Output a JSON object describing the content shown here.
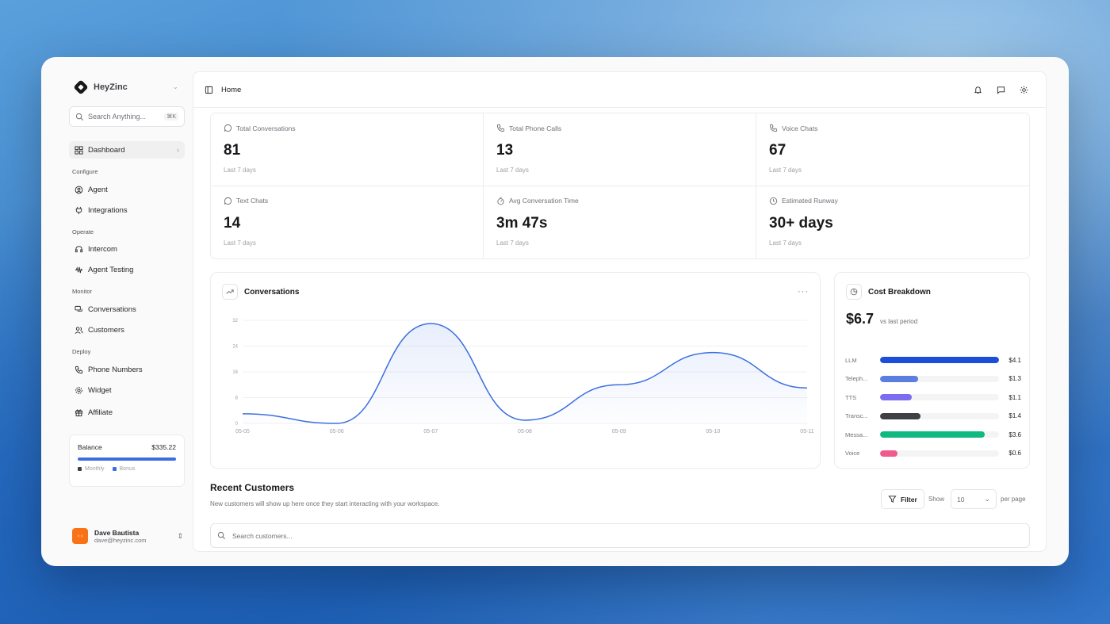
{
  "app": {
    "name": "HeyZinc"
  },
  "search": {
    "placeholder": "Search Anything...",
    "shortcut": "⌘K"
  },
  "sidebar": {
    "dashboard": "Dashboard",
    "sections": {
      "configure": "Configure",
      "operate": "Operate",
      "monitor": "Monitor",
      "deploy": "Deploy"
    },
    "items": {
      "agent": "Agent",
      "integrations": "Integrations",
      "intercom": "Intercom",
      "agent_testing": "Agent Testing",
      "conversations": "Conversations",
      "customers": "Customers",
      "phone_numbers": "Phone Numbers",
      "widget": "Widget",
      "affiliate": "Affiliate"
    }
  },
  "balance": {
    "label": "Balance",
    "amount": "$335.22",
    "legend_monthly": "Monthly",
    "legend_bonus": "Bonus",
    "colors": {
      "monthly": "#3f3f46",
      "bonus": "#3b6fe0"
    }
  },
  "user": {
    "name": "Dave Bautista",
    "email": "dave@heyzinc.com"
  },
  "header": {
    "breadcrumb": "Home"
  },
  "stats": [
    {
      "icon": "message-circle-icon",
      "label": "Total Conversations",
      "value": "81",
      "sub": "Last 7 days"
    },
    {
      "icon": "phone-icon",
      "label": "Total Phone Calls",
      "value": "13",
      "sub": "Last 7 days"
    },
    {
      "icon": "phone-icon",
      "label": "Voice Chats",
      "value": "67",
      "sub": "Last 7 days"
    },
    {
      "icon": "message-circle-icon",
      "label": "Text Chats",
      "value": "14",
      "sub": "Last 7 days"
    },
    {
      "icon": "timer-icon",
      "label": "Avg Conversation Time",
      "value": "3m 47s",
      "sub": "Last 7 days"
    },
    {
      "icon": "clock-icon",
      "label": "Estimated Runway",
      "value": "30+ days",
      "sub": "Last 7 days"
    }
  ],
  "conversations_chart": {
    "title": "Conversations",
    "more": "···"
  },
  "chart_data": {
    "type": "area",
    "title": "Conversations",
    "x": [
      "05-05",
      "05-06",
      "05-07",
      "05-08",
      "05-09",
      "05-10",
      "05-11"
    ],
    "series": [
      {
        "values": [
          3,
          0,
          31,
          1,
          12,
          22,
          11
        ]
      }
    ],
    "yticks": [
      "32",
      "24",
      "16",
      "8",
      "0"
    ],
    "ylim": [
      0,
      32
    ],
    "xlabel": "",
    "ylabel": "",
    "grid": true,
    "color": "#3b6fe0"
  },
  "cost": {
    "title": "Cost Breakdown",
    "total": "$6.7",
    "vs": "vs last period",
    "rows": [
      {
        "name": "LLM",
        "amount": "$4.1",
        "value": 4.1,
        "color": "#1d4ed8"
      },
      {
        "name": "Teleph...",
        "amount": "$1.3",
        "value": 1.3,
        "color": "#5b7fe0"
      },
      {
        "name": "TTS",
        "amount": "$1.1",
        "value": 1.1,
        "color": "#7c6cf0"
      },
      {
        "name": "Transc...",
        "amount": "$1.4",
        "value": 1.4,
        "color": "#3f3f46"
      },
      {
        "name": "Messa...",
        "amount": "$3.6",
        "value": 3.6,
        "color": "#10b981"
      },
      {
        "name": "Voice",
        "amount": "$0.6",
        "value": 0.6,
        "color": "#f05a8c"
      }
    ]
  },
  "recent": {
    "title": "Recent Customers",
    "subtitle": "New customers will show up here once they start interacting with your workspace.",
    "filter": "Filter",
    "show": "Show",
    "per_page_value": "10",
    "per_page": "per page",
    "search_placeholder": "Search customers..."
  }
}
